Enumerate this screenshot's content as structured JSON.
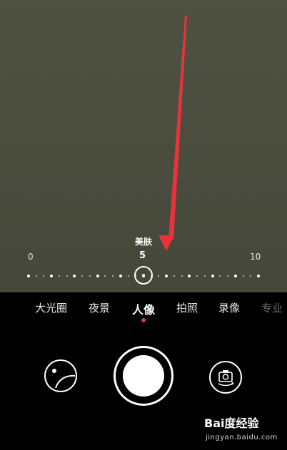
{
  "slider": {
    "label": "美肤",
    "min_label": "0",
    "current_label": "5",
    "max_label": "10",
    "value": 5,
    "min": 0,
    "max": 10
  },
  "modes": [
    {
      "label": "大光圈",
      "state": "normal"
    },
    {
      "label": "夜景",
      "state": "normal"
    },
    {
      "label": "人像",
      "state": "active"
    },
    {
      "label": "拍照",
      "state": "normal"
    },
    {
      "label": "录像",
      "state": "normal"
    },
    {
      "label": "专业",
      "state": "faded"
    }
  ],
  "controls": {
    "left": "effects-icon",
    "center": "shutter",
    "right": "camera-switch-icon"
  },
  "watermark": {
    "logo": "Bai度经验",
    "url": "jingyan.baidu.com"
  },
  "colors": {
    "viewfinder": "#4b4d3f",
    "arrow": "#e8323c",
    "indicator": "#e53935"
  }
}
